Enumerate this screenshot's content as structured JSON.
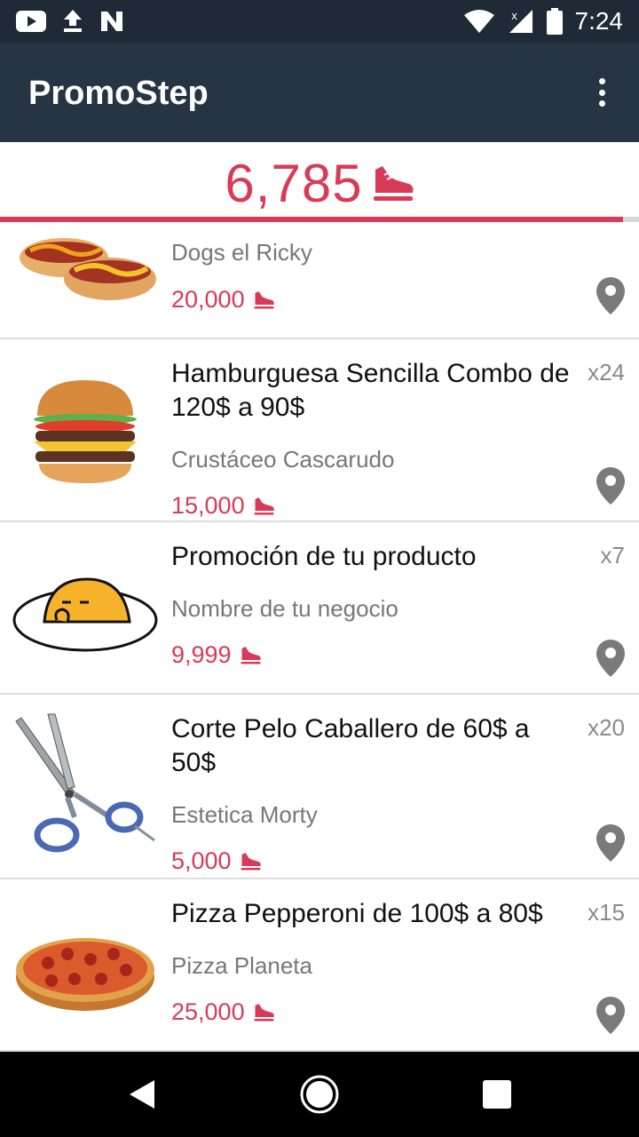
{
  "status_bar": {
    "time": "7:24",
    "left_icons": [
      "youtube-icon",
      "upload-icon",
      "n-icon"
    ],
    "right_icons": [
      "wifi-icon",
      "signal-icon",
      "battery-icon"
    ]
  },
  "app_bar": {
    "title": "PromoStep",
    "menu_icon": "overflow-menu-icon"
  },
  "steps": {
    "count": "6,785",
    "icon": "sneaker-icon",
    "progress": 0.975
  },
  "promotions": [
    {
      "title": "",
      "business": "Dogs el Ricky",
      "cost": "20,000",
      "quantity": "",
      "image": "hotdog"
    },
    {
      "title": "Hamburguesa Sencilla Combo de 120$ a 90$",
      "business": "Crustáceo Cascarudo",
      "cost": "15,000",
      "quantity": "x24",
      "image": "burger"
    },
    {
      "title": "Promoción de tu producto",
      "business": "Nombre de tu negocio",
      "cost": "9,999",
      "quantity": "x7",
      "image": "gudetama"
    },
    {
      "title": "Corte Pelo Caballero de 60$ a 50$",
      "business": "Estetica Morty",
      "cost": "5,000",
      "quantity": "x20",
      "image": "scissors"
    },
    {
      "title": "Pizza Pepperoni de 100$ a 80$",
      "business": "Pizza Planeta",
      "cost": "25,000",
      "quantity": "x15",
      "image": "pizza"
    }
  ],
  "colors": {
    "accent": "#d93a57",
    "app_bar": "#263443",
    "status_bar": "#1f2a36"
  },
  "nav_bar": {
    "buttons": [
      "back-icon",
      "home-icon",
      "recents-icon"
    ]
  }
}
